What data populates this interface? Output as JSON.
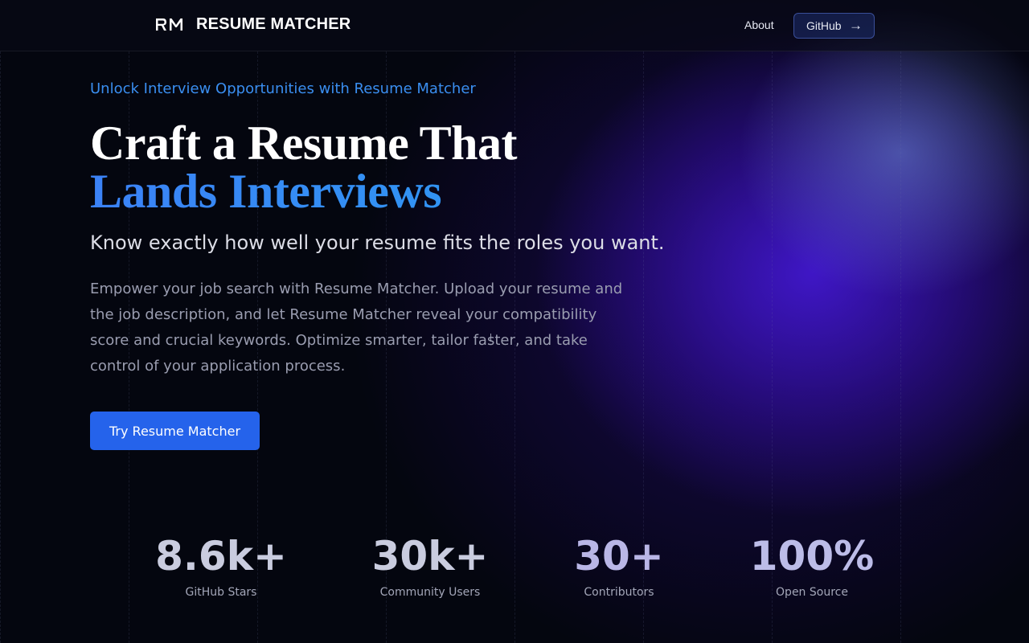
{
  "header": {
    "brand": "RESUME MATCHER",
    "logo_icon": "rm-logo-icon",
    "nav": {
      "about": "About",
      "github": "GitHub",
      "github_arrow": "→"
    }
  },
  "hero": {
    "eyebrow": "Unlock Interview Opportunities with Resume Matcher",
    "headline_line1": "Craft a Resume That",
    "headline_line2": "Lands Interviews",
    "subtitle": "Know exactly how well your resume fits the roles you want.",
    "description": "Empower your job search with Resume Matcher. Upload your resume and the job description, and let Resume Matcher reveal your compatibility score and crucial keywords. Optimize smarter, tailor faster, and take control of your application process.",
    "cta_label": "Try Resume Matcher"
  },
  "stats": [
    {
      "value": "8.6k+",
      "label": "GitHub Stars"
    },
    {
      "value": "30k+",
      "label": "Community Users"
    },
    {
      "value": "30+",
      "label": "Contributors"
    },
    {
      "value": "100%",
      "label": "Open Source"
    }
  ],
  "colors": {
    "accent": "#2563eb",
    "eyebrow": "#3a8ef0",
    "headline_gradient": "#2f97f2",
    "background": "#04060f",
    "glow": "#4619dc"
  }
}
